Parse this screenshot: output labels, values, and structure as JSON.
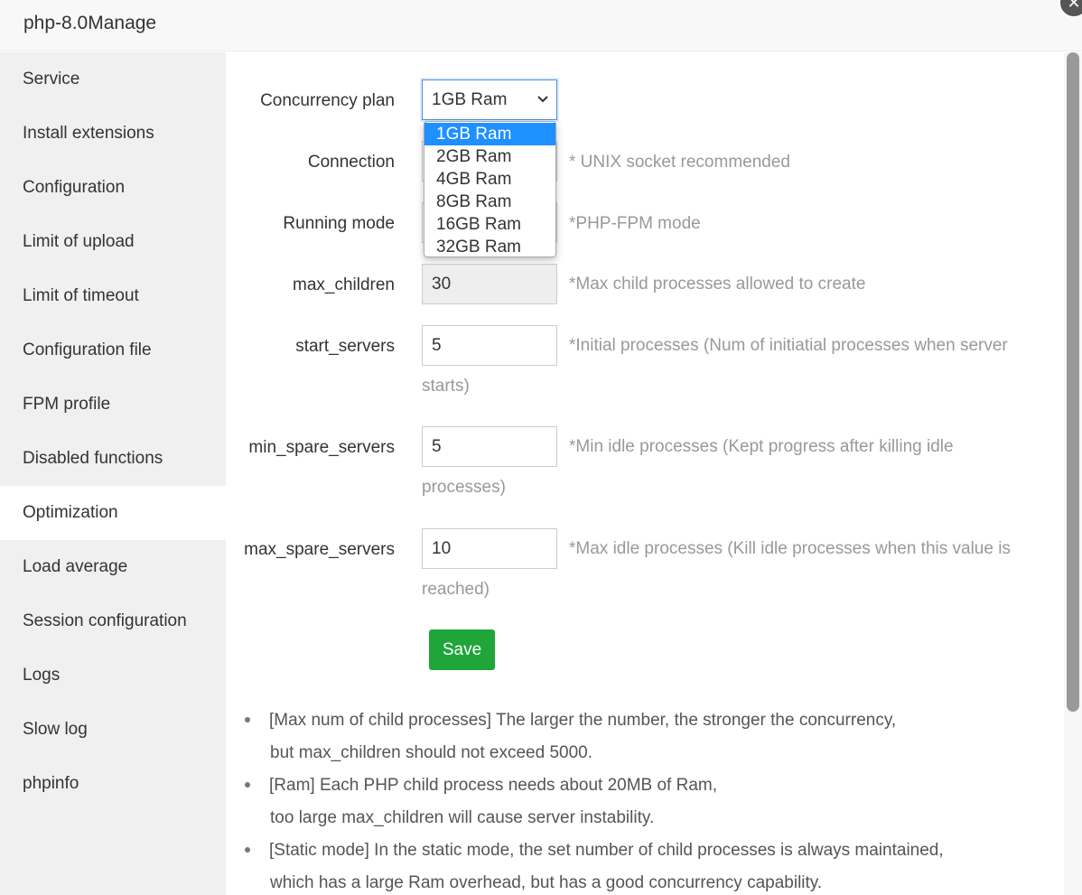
{
  "window": {
    "title": "php-8.0Manage"
  },
  "sidebar": {
    "items": [
      {
        "label": "Service"
      },
      {
        "label": "Install extensions"
      },
      {
        "label": "Configuration"
      },
      {
        "label": "Limit of upload"
      },
      {
        "label": "Limit of timeout"
      },
      {
        "label": "Configuration file"
      },
      {
        "label": "FPM profile"
      },
      {
        "label": "Disabled functions"
      },
      {
        "label": "Optimization"
      },
      {
        "label": "Load average"
      },
      {
        "label": "Session configuration"
      },
      {
        "label": "Logs"
      },
      {
        "label": "Slow log"
      },
      {
        "label": "phpinfo"
      }
    ],
    "active": "Optimization"
  },
  "form": {
    "concurrency_plan": {
      "label": "Concurrency plan",
      "value": "1GB Ram",
      "options": [
        "1GB Ram",
        "2GB Ram",
        "4GB Ram",
        "8GB Ram",
        "16GB Ram",
        "32GB Ram"
      ]
    },
    "connection": {
      "label": "Connection",
      "hint": "* UNIX socket recommended"
    },
    "running_mode": {
      "label": "Running mode",
      "hint": "*PHP-FPM mode"
    },
    "max_children": {
      "label": "max_children",
      "value": "30",
      "hint": "*Max child processes allowed to create"
    },
    "start_servers": {
      "label": "start_servers",
      "value": "5",
      "hint": "*Initial processes (Num of initiatial processes when server",
      "hint2": "starts)"
    },
    "min_spare_servers": {
      "label": "min_spare_servers",
      "value": "5",
      "hint": "*Min idle processes (Kept progress after killing idle",
      "hint2": "processes)"
    },
    "max_spare_servers": {
      "label": "max_spare_servers",
      "value": "10",
      "hint": "*Max idle processes (Kill idle processes when this value is",
      "hint2": "reached)"
    },
    "save_label": "Save"
  },
  "notes": [
    {
      "line1": "[Max num of child processes] The larger the number, the stronger the concurrency,",
      "line2": "but max_children should not exceed 5000."
    },
    {
      "line1": "[Ram] Each PHP child process needs about 20MB of Ram,",
      "line2": "too large max_children will cause server instability."
    },
    {
      "line1": "[Static mode] In the static mode, the set number of child processes is always maintained,",
      "line2": "which has a large Ram overhead, but has a good concurrency capability."
    }
  ],
  "colors": {
    "accent": "#20a53a",
    "selected_option": "#1e90ff",
    "sidebar_bg": "#f0f0f0"
  }
}
